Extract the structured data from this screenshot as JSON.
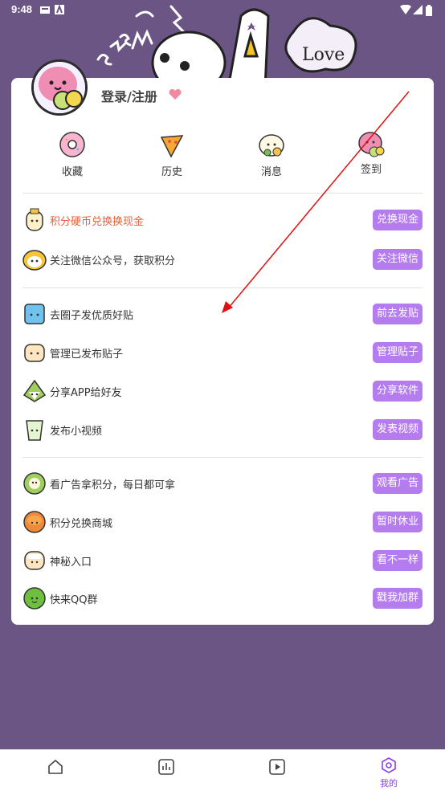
{
  "status": {
    "time": "9:48"
  },
  "profile": {
    "login_label": "登录/注册"
  },
  "quick": [
    {
      "label": "收藏",
      "icon": "donut-icon"
    },
    {
      "label": "历史",
      "icon": "pizza-icon"
    },
    {
      "label": "消息",
      "icon": "bun-icon"
    },
    {
      "label": "签到",
      "icon": "macaron-icon"
    }
  ],
  "rows": [
    {
      "label": "积分硬币兑换换现金",
      "button": "兑换现金",
      "icon": "bottle-icon"
    },
    {
      "label": "关注微信公众号，获取积分",
      "button": "关注微信",
      "icon": "sushi-icon"
    },
    {
      "label": "去圈子发优质好贴",
      "button": "前去发贴",
      "icon": "ice-cube-icon"
    },
    {
      "label": "管理已发布贴子",
      "button": "管理贴子",
      "icon": "toast-icon"
    },
    {
      "label": "分享APP给好友",
      "button": "分享软件",
      "icon": "rice-ball-icon"
    },
    {
      "label": "发布小视频",
      "button": "发表视频",
      "icon": "cup-icon"
    },
    {
      "label": "看广告拿积分，每日都可拿",
      "button": "观看广告",
      "icon": "roll-icon"
    },
    {
      "label": "积分兑换商城",
      "button": "暂时休业",
      "icon": "cookie-icon"
    },
    {
      "label": "神秘入口",
      "button": "看不一样",
      "icon": "dumpling-icon"
    },
    {
      "label": "快来QQ群",
      "button": "戳我加群",
      "icon": "lime-icon"
    }
  ],
  "nav": {
    "mine_label": "我的"
  },
  "colors": {
    "accent": "#b57cf0",
    "hot_text": "#e8603a",
    "background": "#6b5585",
    "arrow": "#e01010"
  }
}
